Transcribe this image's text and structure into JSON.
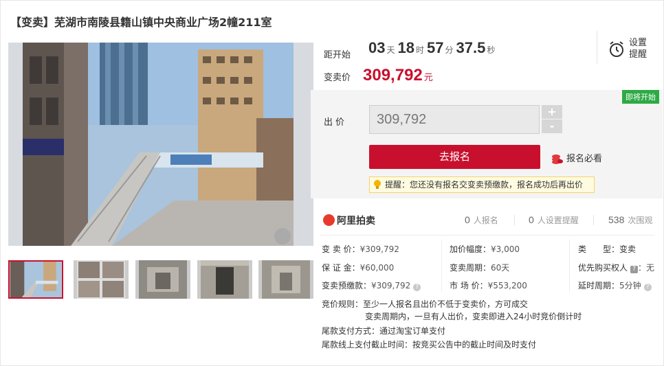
{
  "title": "【变卖】芜湖市南陵县籍山镇中央商业广场2幢211室",
  "countdown": {
    "label": "距开始",
    "days": "03",
    "days_unit": "天",
    "hours": "18",
    "hours_unit": "时",
    "minutes": "57",
    "minutes_unit": "分",
    "seconds": "37.5",
    "seconds_unit": "秒"
  },
  "reminder": {
    "label_line1": "设置",
    "label_line2": "提醒"
  },
  "price": {
    "label": "变卖价",
    "value": "309,792",
    "unit": "元"
  },
  "status_badge": "即将开始",
  "bid": {
    "label": "出价",
    "value": "309,792",
    "plus": "+",
    "minus": "-",
    "signup_button": "去报名",
    "must_read": "报名必看",
    "tip": "提醒：您还没有报名交变卖预缴款，报名成功后再出价"
  },
  "platform": {
    "name": "阿里拍卖",
    "signups_count": "0",
    "signups_label": "人报名",
    "reminders_count": "0",
    "reminders_label": "人设置提醒",
    "views_count": "538",
    "views_label": "次围观"
  },
  "info": {
    "sale_price_label": "变 卖 价：",
    "sale_price": "¥309,792",
    "deposit_label": "保 证 金：",
    "deposit": "¥60,000",
    "prepay_label": "变卖预缴款：",
    "prepay": "¥309,792",
    "increment_label": "加价幅度：",
    "increment": "¥3,000",
    "period_label": "变卖周期：",
    "period": "60天",
    "market_price_label": "市 场 价：",
    "market_price": "¥553,200",
    "type_label": "类　　型：",
    "type": "变卖",
    "priority_label": "优先购买权人",
    "priority_value": "：无",
    "delay_label": "延时周期：",
    "delay": "5分钟"
  },
  "rules": {
    "rule_label": "竞价规则：",
    "rule_line1": "至少一人报名且出价不低于变卖价，方可成交",
    "rule_line2": "变卖周期内，一旦有人出价，变卖即进入24小时竞价倒计时",
    "payment_label": "尾款支付方式：",
    "payment": "通过淘宝订单支付",
    "deadline_label": "尾款线上支付截止时间：",
    "deadline": "按竞买公告中的截止时间及时支付"
  },
  "colors": {
    "accent": "#c8102e",
    "badge": "#2eaa45"
  }
}
